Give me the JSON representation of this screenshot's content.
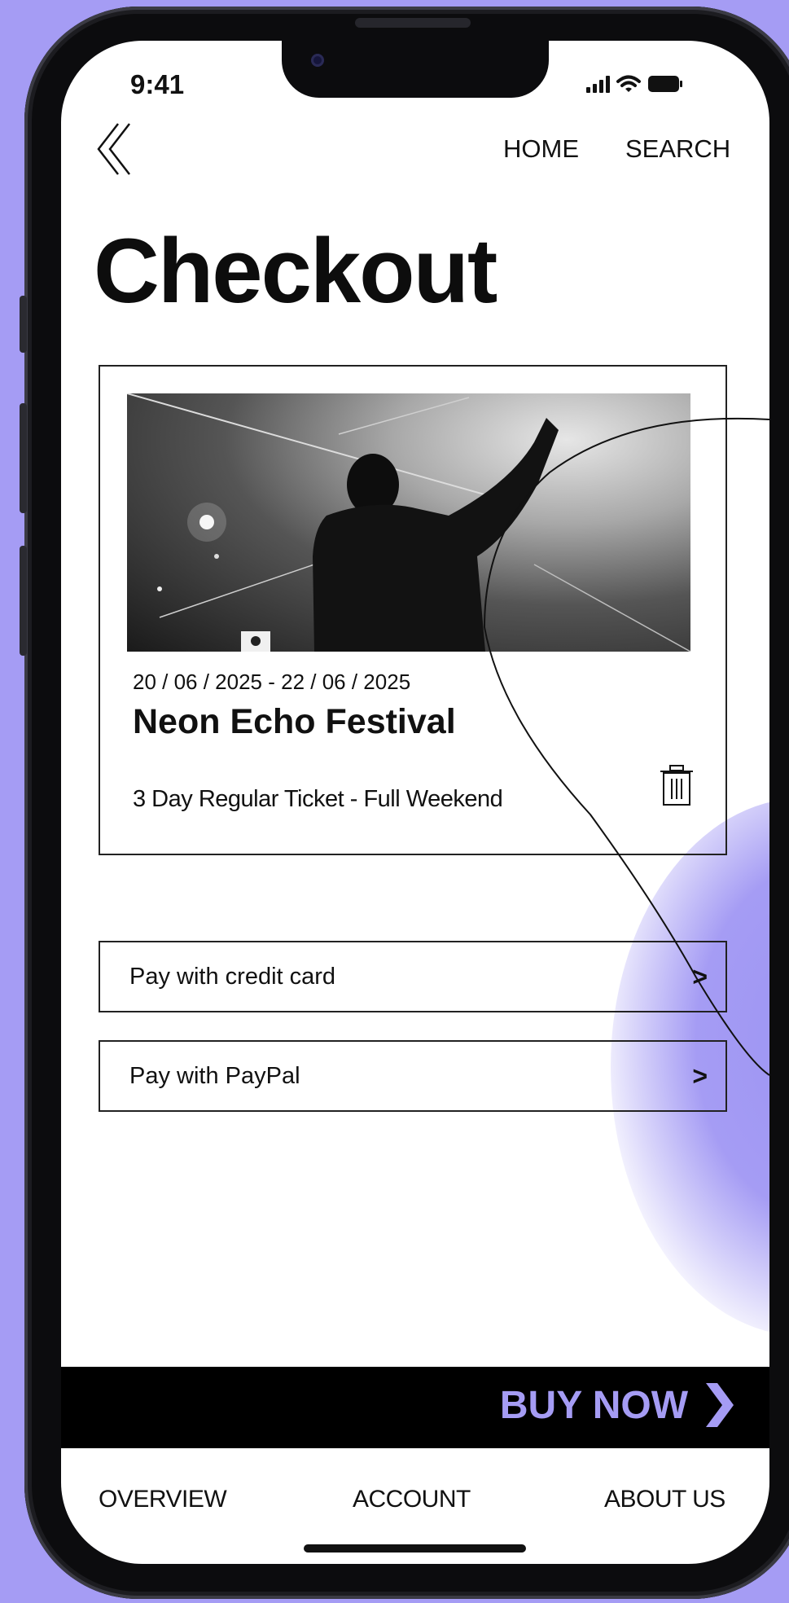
{
  "status_bar": {
    "time": "9:41"
  },
  "header": {
    "back_icon": "double-chevron-left-icon",
    "nav": [
      {
        "label": "HOME"
      },
      {
        "label": "SEARCH"
      }
    ]
  },
  "page": {
    "title": "Checkout"
  },
  "cart_item": {
    "date_range": "20 / 06 / 2025 - 22 / 06 / 2025",
    "event_name": "Neon Echo Festival",
    "ticket_type": "3 Day Regular Ticket - Full Weekend",
    "remove_icon": "trash-icon"
  },
  "payment_options": [
    {
      "label": "Pay with credit card",
      "icon": "chevron-right-icon"
    },
    {
      "label": "Pay with PayPal",
      "icon": "chevron-right-icon"
    }
  ],
  "cta": {
    "label": "BUY NOW",
    "icon": "chevron-right-icon"
  },
  "bottom_nav": [
    {
      "label": "OVERVIEW"
    },
    {
      "label": "ACCOUNT"
    },
    {
      "label": "ABOUT US"
    }
  ],
  "colors": {
    "accent": "#a59cf4",
    "background": "#ffffff",
    "text": "#111111",
    "bar": "#000000"
  }
}
